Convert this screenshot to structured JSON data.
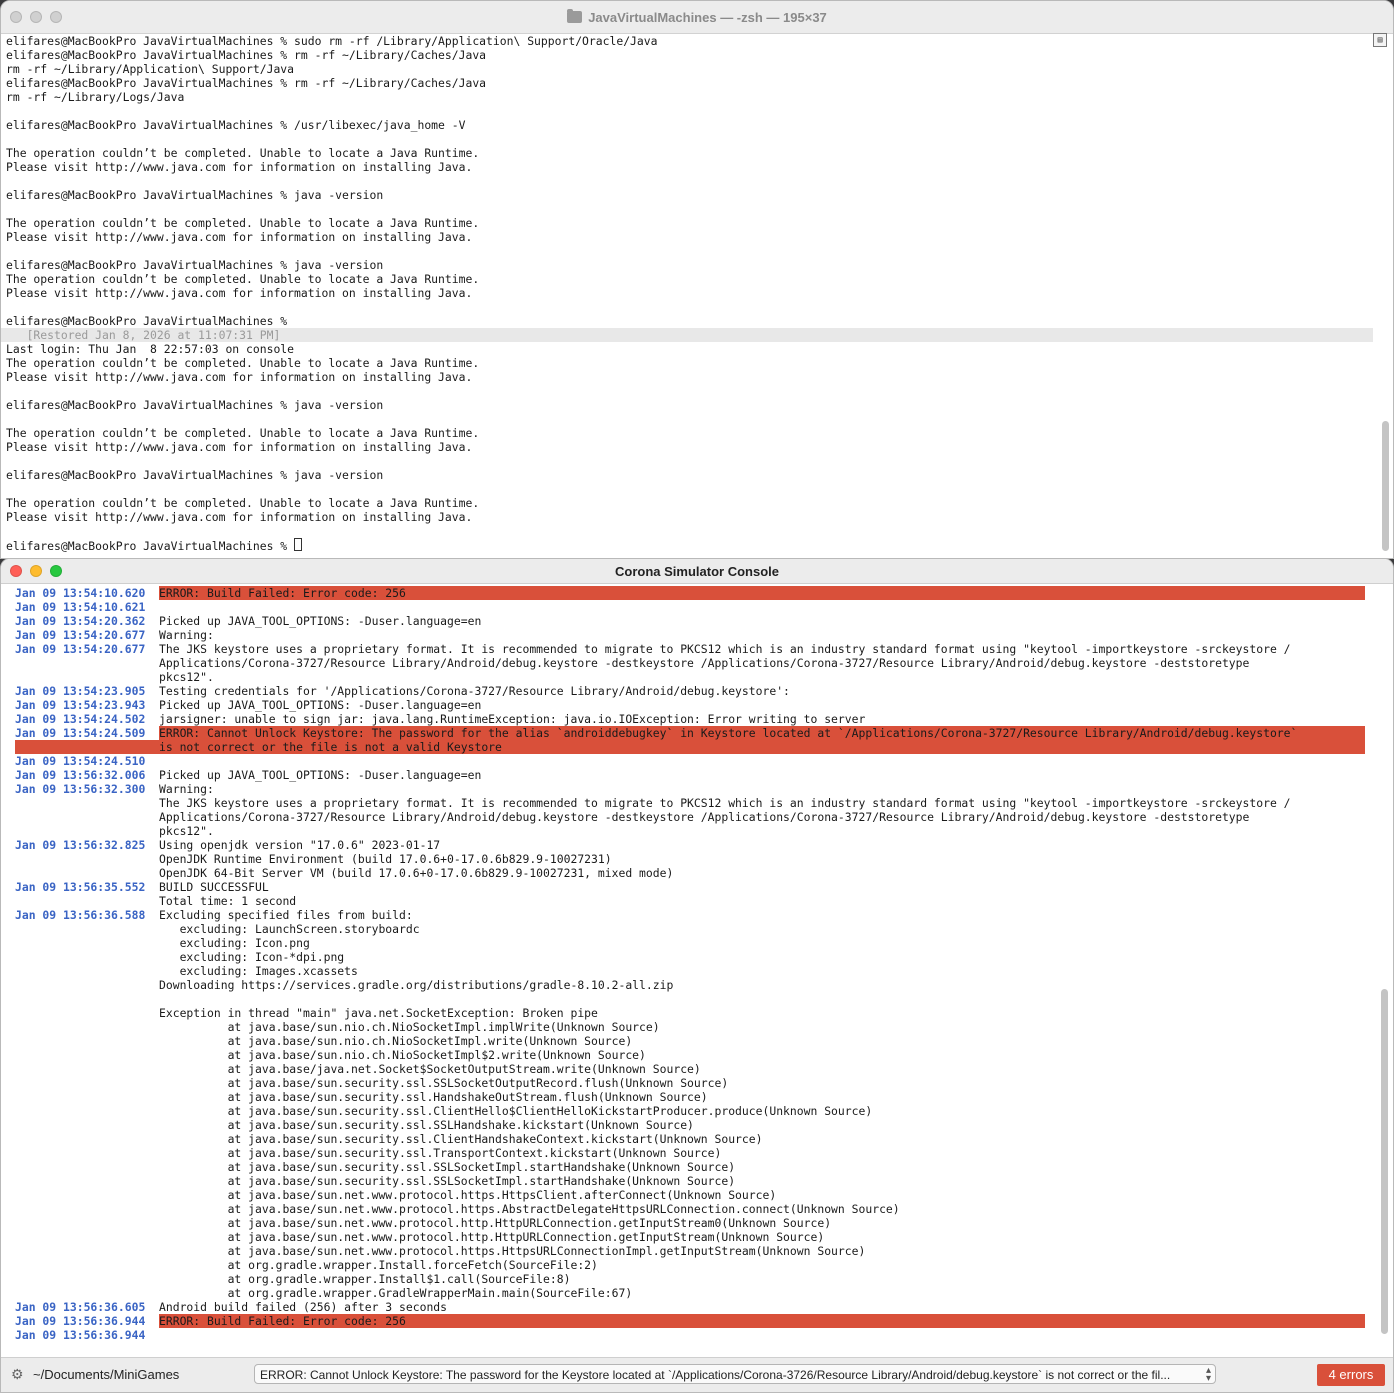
{
  "terminal": {
    "title": "JavaVirtualMachines — -zsh — 195×37",
    "lines": [
      "elifares@MacBookPro JavaVirtualMachines % sudo rm -rf /Library/Application\\ Support/Oracle/Java",
      "elifares@MacBookPro JavaVirtualMachines % rm -rf ~/Library/Caches/Java",
      "rm -rf ~/Library/Application\\ Support/Java",
      "elifares@MacBookPro JavaVirtualMachines % rm -rf ~/Library/Caches/Java",
      "rm -rf ~/Library/Logs/Java",
      "",
      "elifares@MacBookPro JavaVirtualMachines % /usr/libexec/java_home -V",
      "",
      "The operation couldn’t be completed. Unable to locate a Java Runtime.",
      "Please visit http://www.java.com for information on installing Java.",
      "",
      "elifares@MacBookPro JavaVirtualMachines % java -version",
      "",
      "The operation couldn’t be completed. Unable to locate a Java Runtime.",
      "Please visit http://www.java.com for information on installing Java.",
      "",
      "elifares@MacBookPro JavaVirtualMachines % java -version",
      "The operation couldn’t be completed. Unable to locate a Java Runtime.",
      "Please visit http://www.java.com for information on installing Java.",
      "",
      "elifares@MacBookPro JavaVirtualMachines %",
      "   [Restored Jan 8, 2026 at 11:07:31 PM]",
      "Last login: Thu Jan  8 22:57:03 on console",
      "The operation couldn’t be completed. Unable to locate a Java Runtime.",
      "Please visit http://www.java.com for information on installing Java.",
      "",
      "elifares@MacBookPro JavaVirtualMachines % java -version",
      "",
      "The operation couldn’t be completed. Unable to locate a Java Runtime.",
      "Please visit http://www.java.com for information on installing Java.",
      "",
      "elifares@MacBookPro JavaVirtualMachines % java -version",
      "",
      "The operation couldn’t be completed. Unable to locate a Java Runtime.",
      "Please visit http://www.java.com for information on installing Java.",
      "",
      "elifares@MacBookPro JavaVirtualMachines % "
    ],
    "restored_line_index": 21
  },
  "console": {
    "title": "Corona Simulator Console",
    "entries": [
      {
        "ts": "Jan 09 13:54:10.620",
        "msg": "ERROR: Build Failed: Error code: 256",
        "error": true
      },
      {
        "ts": "Jan 09 13:54:10.621",
        "msg": "",
        "error": false
      },
      {
        "ts": "Jan 09 13:54:20.362",
        "msg": "Picked up JAVA_TOOL_OPTIONS: -Duser.language=en",
        "error": false
      },
      {
        "ts": "Jan 09 13:54:20.677",
        "msg": "Warning:",
        "error": false
      },
      {
        "ts": "Jan 09 13:54:20.677",
        "msg": "The JKS keystore uses a proprietary format. It is recommended to migrate to PKCS12 which is an industry standard format using \"keytool -importkeystore -srckeystore /\nApplications/Corona-3727/Resource Library/Android/debug.keystore -destkeystore /Applications/Corona-3727/Resource Library/Android/debug.keystore -deststoretype\npkcs12\".",
        "error": false
      },
      {
        "ts": "Jan 09 13:54:23.905",
        "msg": "Testing credentials for '/Applications/Corona-3727/Resource Library/Android/debug.keystore':",
        "error": false
      },
      {
        "ts": "Jan 09 13:54:23.943",
        "msg": "Picked up JAVA_TOOL_OPTIONS: -Duser.language=en",
        "error": false
      },
      {
        "ts": "Jan 09 13:54:24.502",
        "msg": "jarsigner: unable to sign jar: java.lang.RuntimeException: java.io.IOException: Error writing to server",
        "error": false
      },
      {
        "ts": "Jan 09 13:54:24.509",
        "msg": "ERROR: Cannot Unlock Keystore: The password for the alias `androiddebugkey` in Keystore located at `/Applications/Corona-3727/Resource Library/Android/debug.keystore`\nis not correct or the file is not a valid Keystore",
        "error": true
      },
      {
        "ts": "Jan 09 13:54:24.510",
        "msg": "",
        "error": false
      },
      {
        "ts": "Jan 09 13:56:32.006",
        "msg": "Picked up JAVA_TOOL_OPTIONS: -Duser.language=en",
        "error": false
      },
      {
        "ts": "Jan 09 13:56:32.300",
        "msg": "Warning:\nThe JKS keystore uses a proprietary format. It is recommended to migrate to PKCS12 which is an industry standard format using \"keytool -importkeystore -srckeystore /\nApplications/Corona-3727/Resource Library/Android/debug.keystore -destkeystore /Applications/Corona-3727/Resource Library/Android/debug.keystore -deststoretype\npkcs12\".",
        "error": false
      },
      {
        "ts": "Jan 09 13:56:32.825",
        "msg": "Using openjdk version \"17.0.6\" 2023-01-17\nOpenJDK Runtime Environment (build 17.0.6+0-17.0.6b829.9-10027231)\nOpenJDK 64-Bit Server VM (build 17.0.6+0-17.0.6b829.9-10027231, mixed mode)",
        "error": false
      },
      {
        "ts": "Jan 09 13:56:35.552",
        "msg": "BUILD SUCCESSFUL\nTotal time: 1 second",
        "error": false
      },
      {
        "ts": "Jan 09 13:56:36.588",
        "msg": "Excluding specified files from build:\n   excluding: LaunchScreen.storyboardc\n   excluding: Icon.png\n   excluding: Icon-*dpi.png\n   excluding: Images.xcassets\nDownloading https://services.gradle.org/distributions/gradle-8.10.2-all.zip\n\nException in thread \"main\" java.net.SocketException: Broken pipe\n          at java.base/sun.nio.ch.NioSocketImpl.implWrite(Unknown Source)\n          at java.base/sun.nio.ch.NioSocketImpl.write(Unknown Source)\n          at java.base/sun.nio.ch.NioSocketImpl$2.write(Unknown Source)\n          at java.base/java.net.Socket$SocketOutputStream.write(Unknown Source)\n          at java.base/sun.security.ssl.SSLSocketOutputRecord.flush(Unknown Source)\n          at java.base/sun.security.ssl.HandshakeOutStream.flush(Unknown Source)\n          at java.base/sun.security.ssl.ClientHello$ClientHelloKickstartProducer.produce(Unknown Source)\n          at java.base/sun.security.ssl.SSLHandshake.kickstart(Unknown Source)\n          at java.base/sun.security.ssl.ClientHandshakeContext.kickstart(Unknown Source)\n          at java.base/sun.security.ssl.TransportContext.kickstart(Unknown Source)\n          at java.base/sun.security.ssl.SSLSocketImpl.startHandshake(Unknown Source)\n          at java.base/sun.security.ssl.SSLSocketImpl.startHandshake(Unknown Source)\n          at java.base/sun.net.www.protocol.https.HttpsClient.afterConnect(Unknown Source)\n          at java.base/sun.net.www.protocol.https.AbstractDelegateHttpsURLConnection.connect(Unknown Source)\n          at java.base/sun.net.www.protocol.http.HttpURLConnection.getInputStream0(Unknown Source)\n          at java.base/sun.net.www.protocol.http.HttpURLConnection.getInputStream(Unknown Source)\n          at java.base/sun.net.www.protocol.https.HttpsURLConnectionImpl.getInputStream(Unknown Source)\n          at org.gradle.wrapper.Install.forceFetch(SourceFile:2)\n          at org.gradle.wrapper.Install$1.call(SourceFile:8)\n          at org.gradle.wrapper.GradleWrapperMain.main(SourceFile:67)",
        "error": false
      },
      {
        "ts": "Jan 09 13:56:36.605",
        "msg": "Android build failed (256) after 3 seconds",
        "error": false
      },
      {
        "ts": "Jan 09 13:56:36.944",
        "msg": "ERROR: Build Failed: Error code: 256",
        "error": true
      },
      {
        "ts": "Jan 09 13:56:36.944",
        "msg": "",
        "error": false
      }
    ],
    "status": {
      "path": "~/Documents/MiniGames",
      "selected_error": "ERROR: Cannot Unlock Keystore: The password for the Keystore located at `/Applications/Corona-3726/Resource Library/Android/debug.keystore` is not correct or the fil...",
      "error_count": "4 errors"
    }
  },
  "colors": {
    "timestamp": "#3a64c4",
    "error_bg": "#d9503a"
  },
  "icons": [
    "folder-icon",
    "gear-icon",
    "chevron-updown-icon"
  ]
}
